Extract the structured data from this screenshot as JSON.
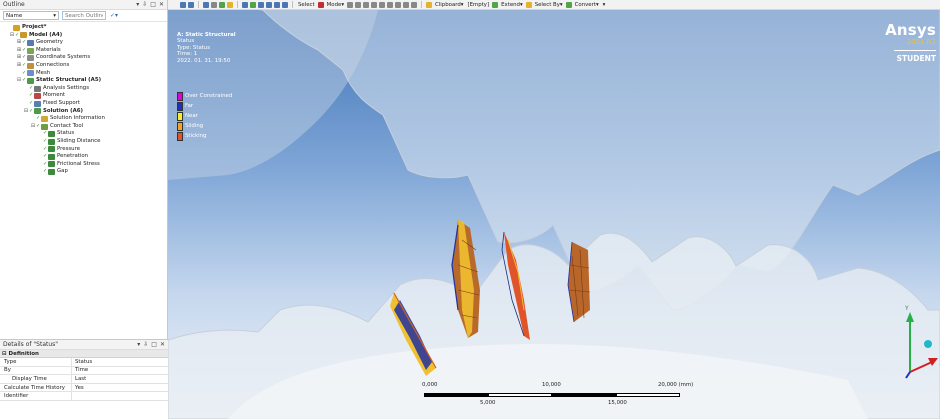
{
  "outline": {
    "title": "Outline",
    "controls": [
      "▾",
      "⇩",
      "□",
      "✕"
    ],
    "filter_label": "Name",
    "search_placeholder": "Search Outline",
    "tree": [
      {
        "label": "Project*",
        "level": 0,
        "icon": "project",
        "bold": true,
        "exp": ""
      },
      {
        "label": "Model (A4)",
        "level": 1,
        "icon": "model",
        "bold": true,
        "exp": "⊟"
      },
      {
        "label": "Geometry",
        "level": 2,
        "icon": "geo",
        "exp": "⊞"
      },
      {
        "label": "Materials",
        "level": 2,
        "icon": "mat",
        "exp": "⊞"
      },
      {
        "label": "Coordinate Systems",
        "level": 2,
        "icon": "coord",
        "exp": "⊞"
      },
      {
        "label": "Connections",
        "level": 2,
        "icon": "conn",
        "exp": "⊞"
      },
      {
        "label": "Mesh",
        "level": 2,
        "icon": "mesh",
        "exp": ""
      },
      {
        "label": "Static Structural (A5)",
        "level": 2,
        "icon": "static",
        "bold": true,
        "exp": "⊟"
      },
      {
        "label": "Analysis Settings",
        "level": 3,
        "icon": "analysis",
        "exp": ""
      },
      {
        "label": "Moment",
        "level": 3,
        "icon": "moment",
        "exp": ""
      },
      {
        "label": "Fixed Support",
        "level": 3,
        "icon": "fixed",
        "exp": ""
      },
      {
        "label": "Solution (A6)",
        "level": 3,
        "icon": "solution",
        "bold": true,
        "exp": "⊟"
      },
      {
        "label": "Solution Information",
        "level": 4,
        "icon": "solinfo",
        "exp": ""
      },
      {
        "label": "Contact Tool",
        "level": 4,
        "icon": "ctool",
        "exp": "⊟"
      },
      {
        "label": "Status",
        "level": 5,
        "icon": "result",
        "exp": ""
      },
      {
        "label": "Sliding Distance",
        "level": 5,
        "icon": "result",
        "exp": ""
      },
      {
        "label": "Pressure",
        "level": 5,
        "icon": "result",
        "exp": ""
      },
      {
        "label": "Penetration",
        "level": 5,
        "icon": "result",
        "exp": ""
      },
      {
        "label": "Frictional Stress",
        "level": 5,
        "icon": "result",
        "exp": ""
      },
      {
        "label": "Gap",
        "level": 5,
        "icon": "result",
        "exp": ""
      }
    ]
  },
  "details": {
    "title": "Details of \"Status\"",
    "controls": [
      "▾",
      "⇩",
      "□",
      "✕"
    ],
    "section": "Definition",
    "rows": [
      {
        "key": "Type",
        "value": "Status",
        "indent": false
      },
      {
        "key": "By",
        "value": "Time",
        "indent": false
      },
      {
        "key": "Display Time",
        "value": "Last",
        "indent": true
      },
      {
        "key": "Calculate Time History",
        "value": "Yes",
        "indent": false
      },
      {
        "key": "Identifier",
        "value": "",
        "indent": false
      }
    ]
  },
  "toolbar": {
    "select_label": "Select",
    "mode_label": "Mode▾",
    "clipboard_label": "Clipboard▾",
    "empty_label": "[Empty]",
    "extend_label": "Extend▾",
    "select_by_label": "Select By▾",
    "convert_label": "Convert▾"
  },
  "viewport": {
    "info": {
      "title": "A: Static Structural",
      "line1": "Status",
      "line2": "Type: Status",
      "line3": "Time: 1",
      "line4": "2022. 01. 31. 19:50"
    },
    "legend": [
      {
        "label": "Over Constrained",
        "color": "#e000e0"
      },
      {
        "label": "Far",
        "color": "#1f2fbf"
      },
      {
        "label": "Near",
        "color": "#f4ef2a"
      },
      {
        "label": "Sliding",
        "color": "#f2a32a"
      },
      {
        "label": "Sticking",
        "color": "#e0542a"
      }
    ],
    "brand": {
      "name": "Ansys",
      "version": "2021 R2",
      "edition": "STUDENT"
    },
    "scale": {
      "top_labels": [
        "0,000",
        "10,000",
        "20,000 (mm)"
      ],
      "bottom_labels": [
        "5,000",
        "15,000"
      ]
    },
    "triad": {
      "y_label": "Y"
    }
  },
  "colors": {
    "accent": "#2b6fb8",
    "contact_orange": "#d26a2a",
    "contact_yellow": "#f0c030",
    "contact_blue": "#2030a0"
  }
}
